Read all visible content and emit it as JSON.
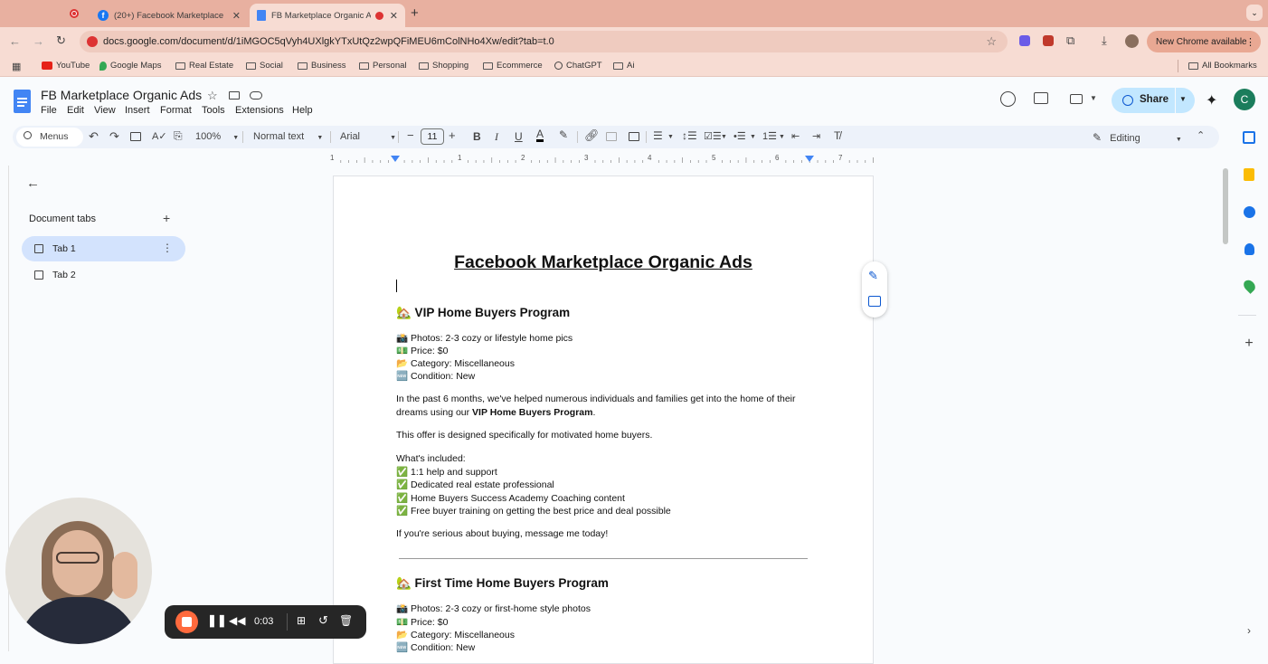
{
  "browser": {
    "tabs": [
      {
        "label": "(20+) Facebook Marketplace"
      },
      {
        "label": "FB Marketplace Organic A"
      }
    ],
    "url": "docs.google.com/document/d/1iMGOC5qVyh4UXlgkYTxUtQz2wpQFiMEU6mColNHo4Xw/edit?tab=t.0",
    "new_chrome": "New Chrome available",
    "bookmarks": [
      "YouTube",
      "Google Maps",
      "Real Estate",
      "Social",
      "Business",
      "Personal",
      "Shopping",
      "Ecommerce",
      "ChatGPT",
      "Ai"
    ],
    "all_bookmarks": "All Bookmarks"
  },
  "docs": {
    "title": "FB Marketplace Organic Ads",
    "menu": [
      "File",
      "Edit",
      "View",
      "Insert",
      "Format",
      "Tools",
      "Extensions",
      "Help"
    ],
    "share_label": "Share",
    "avatar_letter": "C",
    "toolbar": {
      "search": "Menus",
      "zoom": "100%",
      "style": "Normal text",
      "font": "Arial",
      "font_size": "11",
      "mode": "Editing"
    },
    "ruler_numbers": [
      "1",
      "1",
      "2",
      "3",
      "4",
      "5",
      "6",
      "7"
    ],
    "sidebar": {
      "heading": "Document tabs",
      "tabs": [
        "Tab 1",
        "Tab 2"
      ]
    }
  },
  "document": {
    "title": "Facebook Marketplace Organic Ads",
    "section1": {
      "heading": "🏡 VIP Home Buyers Program",
      "bullets": [
        "📸 Photos: 2-3 cozy or lifestyle home pics",
        "💵 Price: $0",
        "📂 Category: Miscellaneous",
        "🆕 Condition: New"
      ],
      "para1_a": "In the past 6 months, we've helped numerous individuals and families get into the home of their",
      "para1_b": "dreams using our ",
      "para1_bold": "VIP Home Buyers Program",
      "para1_end": ".",
      "para2": "This offer is designed specifically for motivated home buyers.",
      "included_label": "What's included:",
      "included": [
        "✅ 1:1 help and support",
        "✅ Dedicated real estate professional",
        "✅ Home Buyers Success Academy Coaching content",
        "✅ Free buyer training on getting the best price and deal possible"
      ],
      "cta": "If you're serious about buying, message me today!"
    },
    "section2": {
      "heading": "🏡 First Time Home Buyers Program",
      "bullets": [
        "📸 Photos: 2-3 cozy or first-home style photos",
        "💵 Price: $0",
        "📂 Category: Miscellaneous",
        "🆕 Condition: New"
      ]
    }
  },
  "recorder": {
    "time": "0:03"
  }
}
